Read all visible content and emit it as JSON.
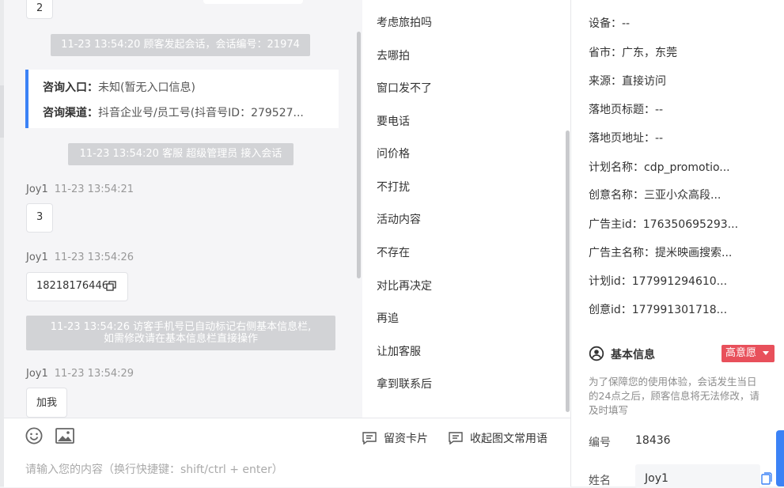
{
  "chat": {
    "top_bubble": "2",
    "sys1": "11-23 13:54:20 顾客发起会话，会话编号：21974",
    "card": {
      "entry_label": "咨询入口：",
      "entry_value": "未知(暂无入口信息)",
      "channel_label": "咨询渠道：",
      "channel_value": "抖音企业号/员工号(抖音号ID：279527..."
    },
    "sys2": "11-23 13:54:20 客服 超级管理员 接入会话",
    "msg1": {
      "name": "Joy1",
      "time": "11-23 13:54:21",
      "text": "3"
    },
    "msg2": {
      "name": "Joy1",
      "time": "11-23 13:54:26",
      "text": "18218176446"
    },
    "sys3_line1": "11-23 13:54:26 访客手机号已自动标记右侧基本信息栏,",
    "sys3_line2": "如需修改请在基本信息栏直接操作",
    "msg3": {
      "name": "Joy1",
      "time": "11-23 13:54:29",
      "text": "加我"
    }
  },
  "phrases": [
    "考虑旅拍吗",
    "去哪拍",
    "窗口发不了",
    "要电话",
    "问价格",
    "不打扰",
    "活动内容",
    "不存在",
    "对比再决定",
    "再追",
    "让加客服",
    "拿到联系后"
  ],
  "info": {
    "device": "设备：--",
    "region": "省市：广东，东莞",
    "source": "来源：直接访问",
    "landing_title": "落地页标题：--",
    "landing_url": "落地页地址：--",
    "plan_name": "计划名称：cdp_promotio...",
    "creative_name": "创意名称：三亚小众高段...",
    "advertiser_id": "广告主id：176350695293...",
    "advertiser_name": "广告主名称：提米映画搜索...",
    "plan_id": "计划id：177991294610...",
    "creative_id": "创意id：177991301718..."
  },
  "basic": {
    "title": "基本信息",
    "badge": "高意愿",
    "notice": [
      "为了保障您的使用体验，会话发生当日",
      "的24点之后，顾客信息将无法修改，请",
      "及时填写"
    ],
    "number_label": "编号",
    "number_value": "18436",
    "name_label": "姓名",
    "name_value": "Joy1"
  },
  "toolbar": {
    "card_label": "留资卡片",
    "collapse_label": "收起图文常用语",
    "placeholder": "请输入您的内容（换行快捷键：shift/ctrl + enter）"
  },
  "colors": {
    "accent": "#3b82f6",
    "badge": "#e8505b",
    "system": "#d2d3d6"
  }
}
